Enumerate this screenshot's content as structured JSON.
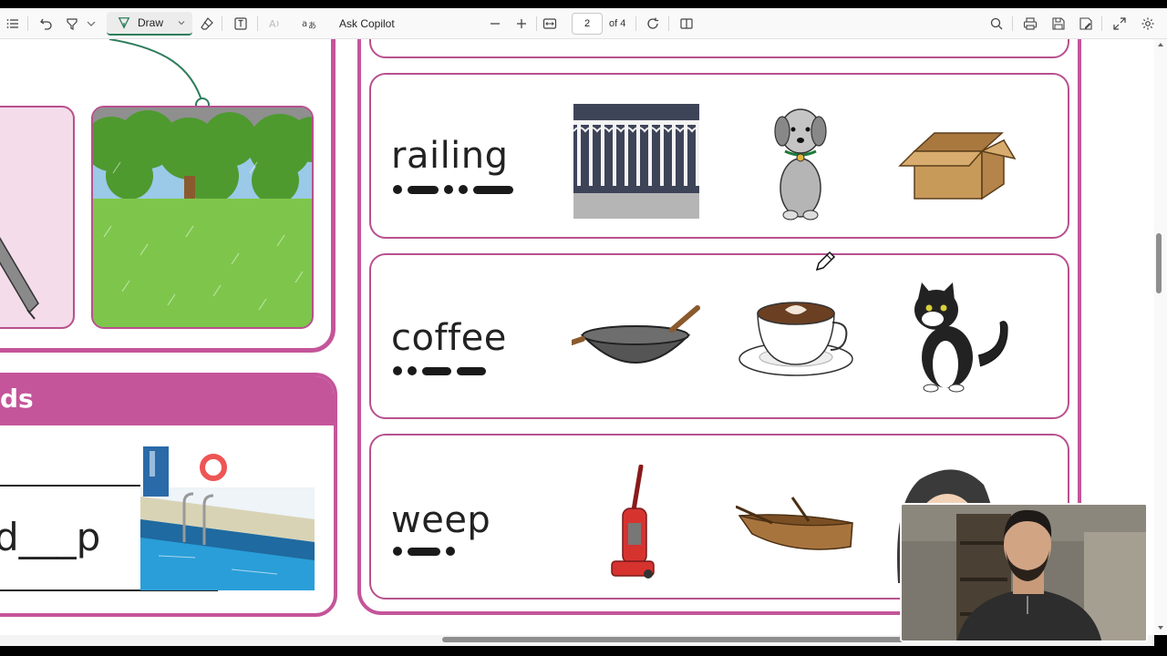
{
  "toolbar": {
    "draw_label": "Draw",
    "ask_copilot_label": "Ask Copilot",
    "page_number": "2",
    "page_total": "of 4",
    "icons": [
      "contents-icon",
      "undo-icon",
      "highlight-icon",
      "chevron-down-icon",
      "draw-icon",
      "eraser-icon",
      "text-box-icon",
      "read-aloud-icon",
      "translate-icon",
      "zoom-out-icon",
      "zoom-in-icon",
      "fit-page-icon",
      "rotate-icon",
      "page-view-icon",
      "search-icon",
      "print-icon",
      "save-icon",
      "save-as-icon",
      "fullscreen-icon",
      "settings-icon"
    ]
  },
  "worksheet": {
    "left_header_fragment": "ds",
    "left_fill_word_fragment": "d___p",
    "word_rows": [
      {
        "word": "railing",
        "sounds": [
          "dot",
          "dash",
          "dot",
          "dot",
          "dash"
        ],
        "pictures": [
          "railing-picture",
          "dog-picture",
          "box-picture"
        ]
      },
      {
        "word": "coffee",
        "sounds": [
          "dot",
          "dot",
          "dash",
          "dash"
        ],
        "pictures": [
          "wok-picture",
          "coffee-cup-picture",
          "cat-picture"
        ]
      },
      {
        "word": "weep",
        "sounds": [
          "dot",
          "dash",
          "dot"
        ],
        "pictures": [
          "vacuum-picture",
          "rowing-boat-picture",
          "person-picture"
        ]
      }
    ]
  },
  "colors": {
    "card_border": "#b8508e",
    "header_fill": "#c4559a",
    "left_card_fill": "#f4dcea",
    "draw_accent": "#2f7d5b"
  }
}
